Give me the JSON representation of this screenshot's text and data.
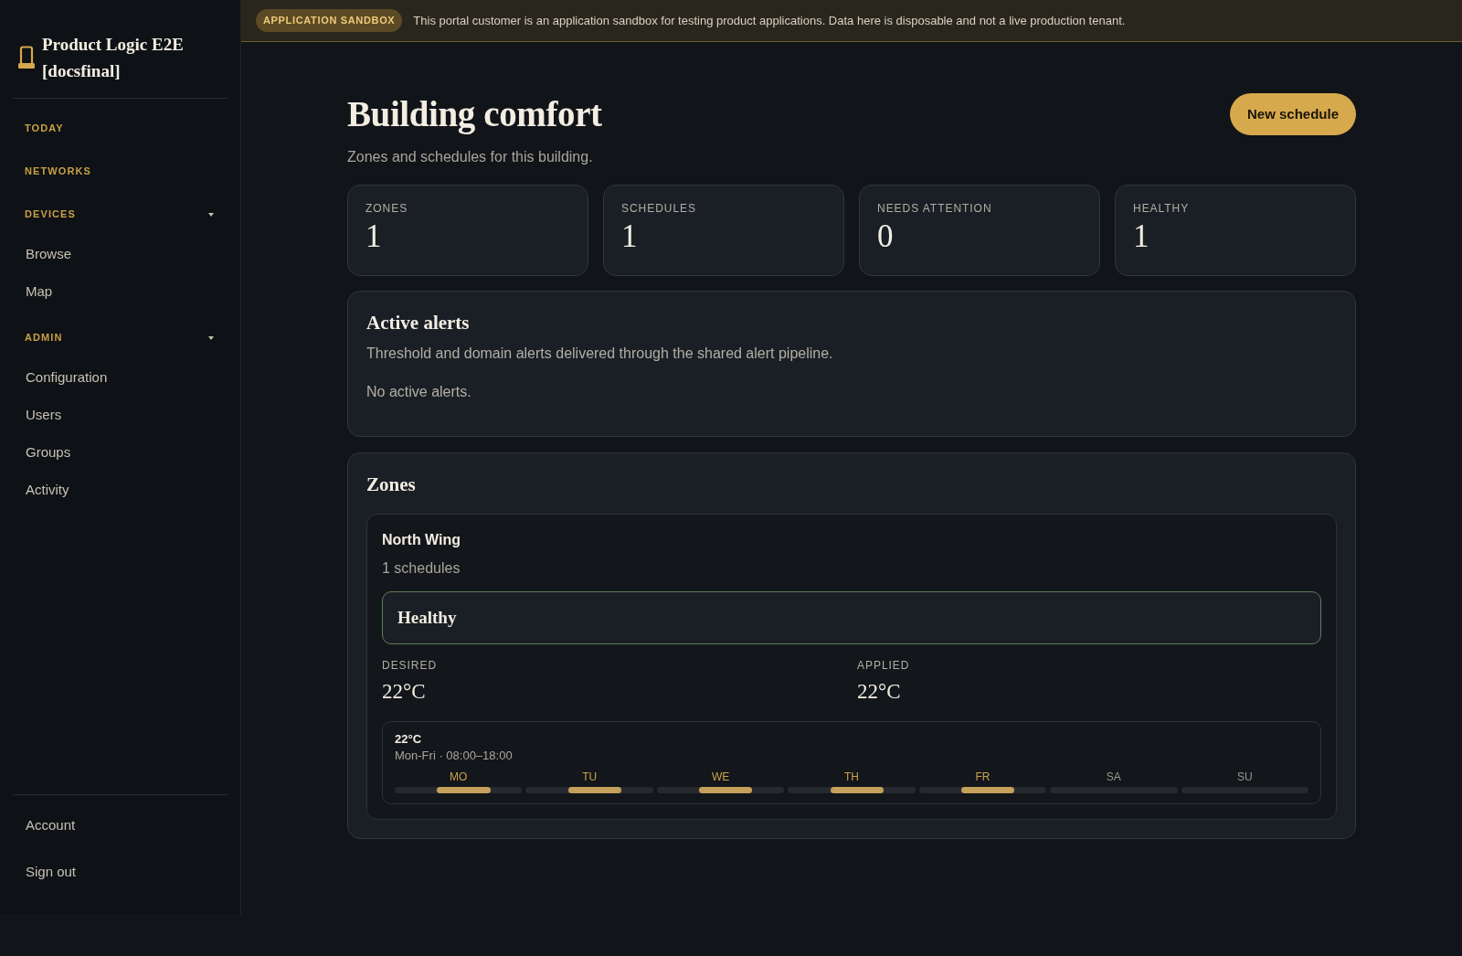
{
  "banner": {
    "badge": "APPLICATION SANDBOX",
    "message": "This portal customer is an application sandbox for testing product applications. Data here is disposable and not a live production tenant."
  },
  "sidebar": {
    "brand": "Product Logic E2E [docsfinal]",
    "sections": [
      {
        "label": "TODAY",
        "selected": false
      },
      {
        "label": "NETWORKS",
        "selected": false
      },
      {
        "label": "DEVICES",
        "selected": false,
        "expanded": true,
        "children": [
          {
            "label": "Browse",
            "selected": false
          },
          {
            "label": "Map",
            "selected": false
          }
        ]
      },
      {
        "label": "ADMIN",
        "selected": false,
        "expanded": true,
        "children": [
          {
            "label": "Configuration",
            "selected": false
          },
          {
            "label": "Users",
            "selected": false
          },
          {
            "label": "Groups",
            "selected": false
          },
          {
            "label": "Activity",
            "selected": false
          }
        ]
      }
    ],
    "footer": [
      {
        "label": "Account",
        "selected": false
      },
      {
        "label": "Sign out",
        "selected": false
      }
    ]
  },
  "page": {
    "title": "Building comfort",
    "subtitle": "Zones and schedules for this building.",
    "primary_button": "New schedule"
  },
  "stats": [
    {
      "label": "ZONES",
      "value": "1"
    },
    {
      "label": "SCHEDULES",
      "value": "1"
    },
    {
      "label": "NEEDS ATTENTION",
      "value": "0"
    },
    {
      "label": "HEALTHY",
      "value": "1"
    }
  ],
  "alerts": {
    "title": "Active alerts",
    "description": "Threshold and domain alerts delivered through the shared alert pipeline.",
    "empty_message": "No active alerts."
  },
  "zones": {
    "title": "Zones",
    "items": [
      {
        "name": "North Wing",
        "schedule_count": "1 schedules",
        "status": {
          "label": "Healthy",
          "kind": "healthy"
        },
        "readings": [
          {
            "label": "DESIRED",
            "value": "22°C"
          },
          {
            "label": "APPLIED",
            "value": "22°C"
          }
        ],
        "schedules": [
          {
            "temperature": "22°C",
            "summary": "Mon-Fri · 08:00–18:00",
            "days": [
              {
                "label": "MO",
                "active": true
              },
              {
                "label": "TU",
                "active": true
              },
              {
                "label": "WE",
                "active": true
              },
              {
                "label": "TH",
                "active": true
              },
              {
                "label": "FR",
                "active": true
              },
              {
                "label": "SA",
                "active": false
              },
              {
                "label": "SU",
                "active": false
              }
            ]
          }
        ]
      }
    ]
  }
}
